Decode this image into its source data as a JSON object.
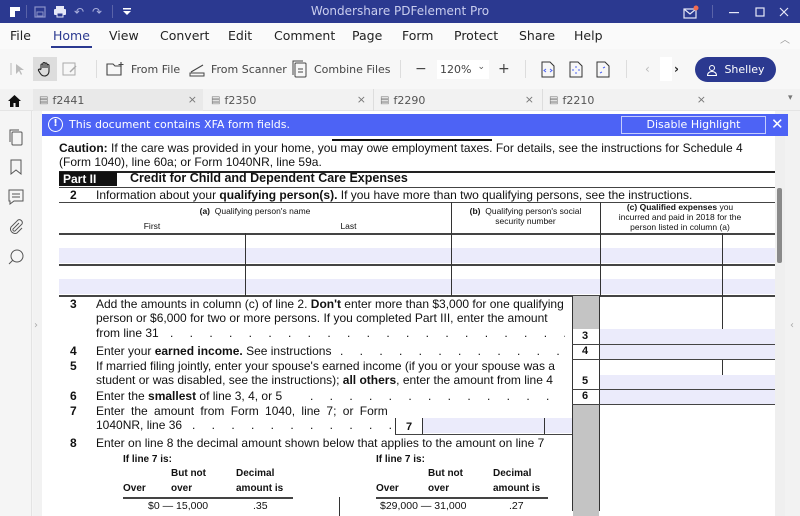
{
  "app": {
    "title": "Wondershare PDFelement Pro",
    "quick_access": [
      "logo-icon",
      "save-icon",
      "print-icon",
      "undo-icon",
      "redo-icon",
      "customize-icon"
    ],
    "window_controls": [
      "mail-icon",
      "minimize-icon",
      "maximize-icon",
      "close-icon"
    ]
  },
  "menu": {
    "items": [
      "File",
      "Home",
      "View",
      "Convert",
      "Edit",
      "Comment",
      "Page",
      "Form",
      "Protect",
      "Share",
      "Help"
    ],
    "active": "Home"
  },
  "toolbar": {
    "from_file": "From File",
    "from_scanner": "From Scanner",
    "combine_files": "Combine Files",
    "zoom_level": "120%",
    "zoom_out": "−",
    "zoom_in": "+",
    "user": "Shelley"
  },
  "tabs": [
    {
      "label": "f2441",
      "active": true
    },
    {
      "label": "f2350",
      "active": false
    },
    {
      "label": "f2290",
      "active": false
    },
    {
      "label": "f2210",
      "active": false
    }
  ],
  "banner": {
    "message": "This document contains XFA form fields.",
    "button": "Disable Highlight",
    "color": "#4d63f5"
  },
  "form": {
    "caution_bold": "Caution:",
    "caution_line1": " If the care was provided in your home, you may owe employment taxes. For details, see the instructions for Schedule 4",
    "caution_line2": "(Form 1040), line 60a; or Form 1040NR, line 59a.",
    "part_label": "Part II",
    "part_title": "Credit for Child and Dependent Care Expenses",
    "line2_num": "2",
    "line2_pre": "Information about your ",
    "line2_bold": "qualifying person(s).",
    "line2_post": " If you have more than two qualifying persons, see the instructions.",
    "col_a_label": "(a)",
    "col_a_text": "Qualifying person's name",
    "col_a_first": "First",
    "col_a_last": "Last",
    "col_b_label": "(b)",
    "col_b_text1": "Qualifying person's social",
    "col_b_text2": "security number",
    "col_c_bold": "(c) Qualified expenses",
    "col_c_text1": " you",
    "col_c_text2": "incurred and paid in 2018 for the",
    "col_c_text3": "person listed in column (a)",
    "line3_num": "3",
    "line3_a": "Add the amounts in column (c) of line 2. ",
    "line3_bold": "Don't",
    "line3_b": " enter more than $3,000 for one qualifying",
    "line3_c": "person or $6,000 for two or more persons. If you completed Part III, enter the amount",
    "line3_d": "from line 31",
    "line4_num": "4",
    "line4_a": "Enter your ",
    "line4_bold": "earned income.",
    "line4_b": " See instructions",
    "line5_num": "5",
    "line5_a": "If married filing jointly, enter your spouse's earned income (if you or your spouse was a",
    "line5_b": "student or was disabled, see the instructions); ",
    "line5_bold": "all others",
    "line5_c": ", enter the amount from line 4",
    "line6_num": "6",
    "line6_a": "Enter the ",
    "line6_bold": "smallest",
    "line6_b": " of line 3, 4, or 5",
    "line7_num": "7",
    "line7_a": "Enter the amount from Form 1040, line 7; or Form",
    "line7_b": "1040NR, line 36",
    "line8_num": "8",
    "line8_text": "Enter on line 8 the decimal amount shown below that applies to the amount on line 7",
    "table_if": "If line 7 is:",
    "table_but_not": "But not",
    "table_over": "Over",
    "table_over2": "over",
    "table_decimal": "Decimal",
    "table_amount_is": "amount is",
    "left_rows": [
      {
        "range": "$0 — 15,000",
        "decimal": ".35"
      }
    ],
    "right_rows": [
      {
        "range": "$29,000 — 31,000",
        "decimal": ".27"
      }
    ],
    "dots": ". . . . . . . . . . . . . . . . . . . . . . . . ."
  }
}
